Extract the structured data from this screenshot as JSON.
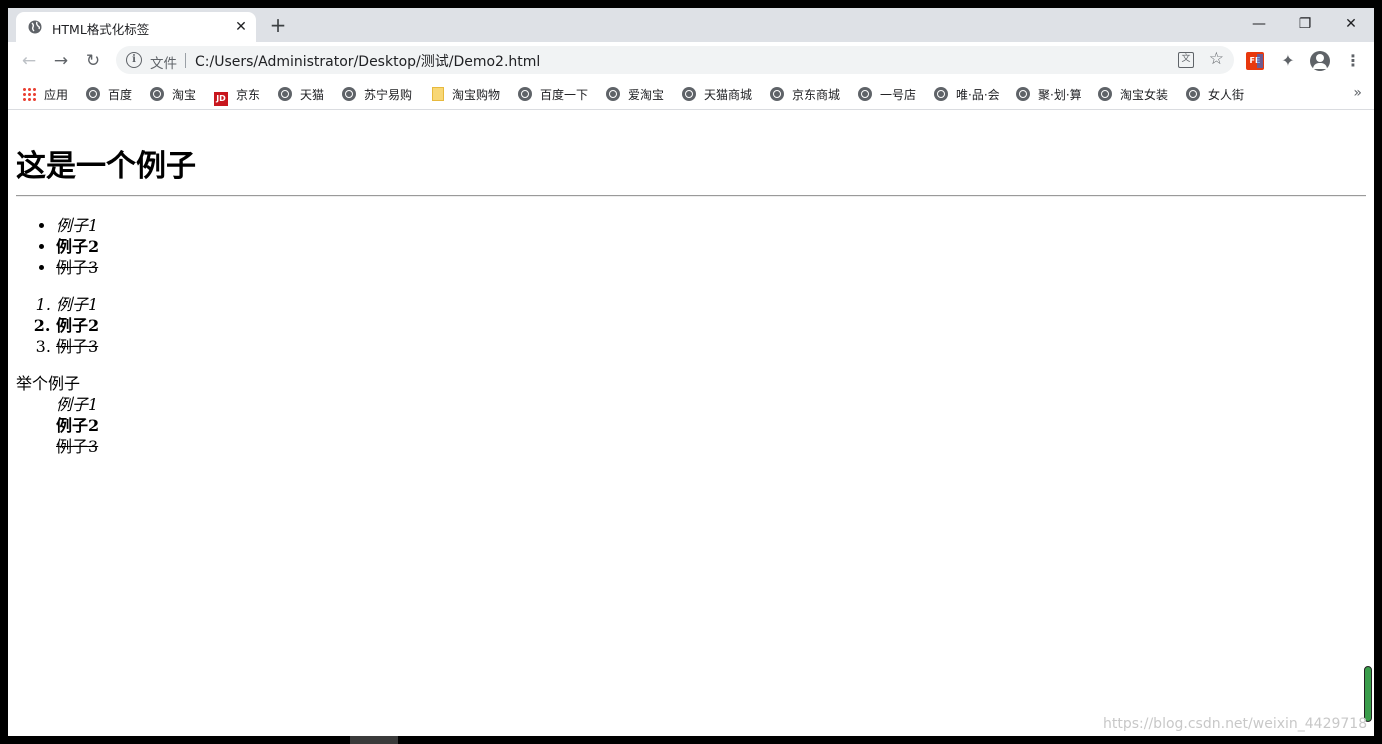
{
  "tab": {
    "title": "HTML格式化标签",
    "favicon": "globe-icon"
  },
  "toolbar": {
    "scheme_label": "文件",
    "url": "C:/Users/Administrator/Desktop/测试/Demo2.html"
  },
  "bookmarks": [
    {
      "label": "应用",
      "icon": "apps-icon"
    },
    {
      "label": "百度",
      "icon": "globe-icon"
    },
    {
      "label": "淘宝",
      "icon": "globe-icon"
    },
    {
      "label": "京东",
      "icon": "jd-icon"
    },
    {
      "label": "天猫",
      "icon": "globe-icon"
    },
    {
      "label": "苏宁易购",
      "icon": "globe-icon"
    },
    {
      "label": "淘宝购物",
      "icon": "folder-icon"
    },
    {
      "label": "百度一下",
      "icon": "globe-icon"
    },
    {
      "label": "爱淘宝",
      "icon": "globe-icon"
    },
    {
      "label": "天猫商城",
      "icon": "globe-icon"
    },
    {
      "label": "京东商城",
      "icon": "globe-icon"
    },
    {
      "label": "一号店",
      "icon": "globe-icon"
    },
    {
      "label": "唯·品·会",
      "icon": "globe-icon"
    },
    {
      "label": "聚·划·算",
      "icon": "globe-icon"
    },
    {
      "label": "淘宝女装",
      "icon": "globe-icon"
    },
    {
      "label": "女人街",
      "icon": "globe-icon"
    }
  ],
  "page": {
    "heading": "这是一个例子",
    "unordered": [
      "例子1",
      "例子2",
      "例子3"
    ],
    "ordered": [
      "例子1",
      "例子2",
      "例子3"
    ],
    "dl_term": "举个例子",
    "dl_items": [
      "例子1",
      "例子2",
      "例子3"
    ]
  },
  "watermark": "https://blog.csdn.net/weixin_4429718"
}
